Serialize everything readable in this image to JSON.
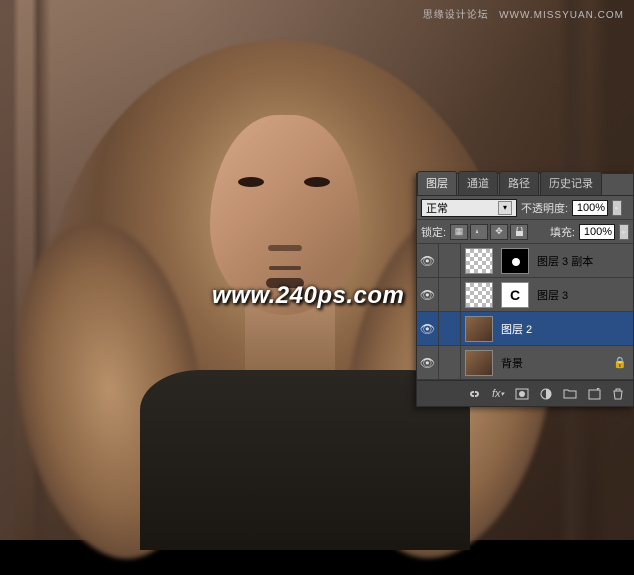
{
  "watermark": {
    "top_main": "思缘设计论坛",
    "top_sub": "WWW.MISSYUAN.COM",
    "center": "www.240ps.com"
  },
  "panel": {
    "tabs": [
      "图层",
      "通道",
      "路径",
      "历史记录"
    ],
    "active_tab_index": 0,
    "blend_mode_label": "正常",
    "opacity_label": "不透明度:",
    "opacity_value": "100%",
    "lock_label": "锁定:",
    "fill_label": "填充:",
    "fill_value": "100%",
    "layers": [
      {
        "name": "图层 3 副本",
        "visible": true,
        "selected": false,
        "thumbs": [
          "checker",
          "maskdot"
        ]
      },
      {
        "name": "图层 3",
        "visible": true,
        "selected": false,
        "thumbs": [
          "checker",
          "maskC"
        ]
      },
      {
        "name": "图层 2",
        "visible": true,
        "selected": true,
        "thumbs": [
          "img"
        ]
      },
      {
        "name": "背景",
        "visible": true,
        "selected": false,
        "thumbs": [
          "img"
        ],
        "locked": true
      }
    ],
    "footer_icons": [
      "link",
      "fx",
      "mask",
      "adjust",
      "group",
      "new",
      "trash"
    ]
  }
}
